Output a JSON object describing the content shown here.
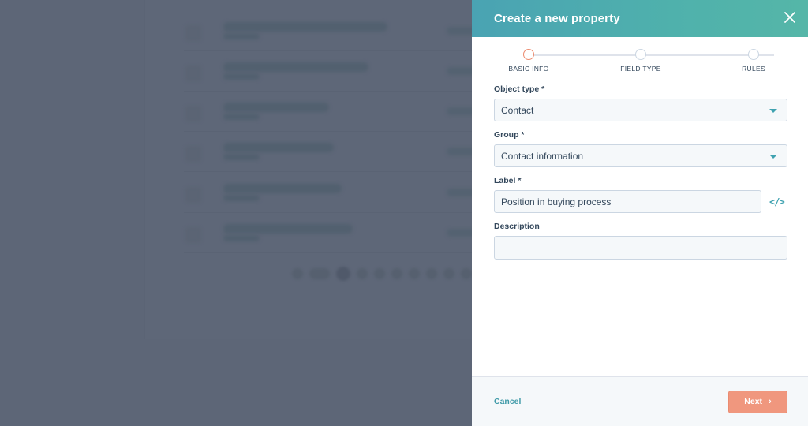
{
  "panel": {
    "title": "Create a new property",
    "close_icon": "close-icon"
  },
  "stepper": {
    "steps": [
      {
        "label": "BASIC INFO",
        "state": "active"
      },
      {
        "label": "FIELD TYPE",
        "state": "upcoming"
      },
      {
        "label": "RULES",
        "state": "upcoming"
      }
    ]
  },
  "form": {
    "object_type": {
      "label": "Object type *",
      "value": "Contact"
    },
    "group": {
      "label": "Group *",
      "value": "Contact information"
    },
    "label_field": {
      "label": "Label *",
      "value": "Position in buying process",
      "icon": "code-icon"
    },
    "description": {
      "label": "Description",
      "value": ""
    }
  },
  "footer": {
    "cancel_label": "Cancel",
    "next_label": "Next"
  },
  "colors": {
    "header_start": "#4aa3b3",
    "header_end": "#55b6a8",
    "accent_teal": "#3fa2b0",
    "primary_button": "#f0977e",
    "active_step": "#ec8b6f",
    "overlay": "#5d6677"
  }
}
